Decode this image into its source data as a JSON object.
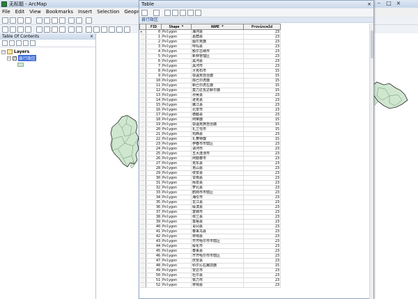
{
  "app": {
    "window_title": "无标题 - ArcMap",
    "menus": [
      "File",
      "Edit",
      "View",
      "Bookmarks",
      "Insert",
      "Selection",
      "Geoprocessing"
    ],
    "toc_title": "Table Of Contents",
    "layers_label": "Layers",
    "layer_name": "县行政区"
  },
  "table_window": {
    "title": "Table",
    "close": "×",
    "tab_label": "县行政区",
    "columns": [
      "FID",
      "Shape *",
      "NAME *",
      "ProvinceId"
    ],
    "rows": [
      [
        "0",
        "Polygon",
        "海河县",
        "23"
      ],
      [
        "1",
        "Polygon",
        "嘉荫县",
        "23"
      ],
      [
        "2",
        "Polygon",
        "图尔克旗",
        "23"
      ],
      [
        "3",
        "Polygon",
        "呼玛县",
        "23"
      ],
      [
        "4",
        "Polygon",
        "额尔古纳市",
        "23"
      ],
      [
        "5",
        "Polygon",
        "新林管理区",
        "23"
      ],
      [
        "6",
        "Polygon",
        "黑河县",
        "23"
      ],
      [
        "7",
        "Polygon",
        "黑河市",
        "23"
      ],
      [
        "8",
        "Polygon",
        "牙克石市",
        "15"
      ],
      [
        "9",
        "Polygon",
        "鄂温克自治旗",
        "15"
      ],
      [
        "10",
        "Polygon",
        "陈巴尔虎旗",
        "15"
      ],
      [
        "11",
        "Polygon",
        "新巴尔虎左旗",
        "15"
      ],
      [
        "12",
        "Polygon",
        "莫力达瓦达斡尔旗",
        "15"
      ],
      [
        "13",
        "Polygon",
        "孙吴县",
        "23"
      ],
      [
        "14",
        "Polygon",
        "逊克县",
        "23"
      ],
      [
        "15",
        "Polygon",
        "嫩江县",
        "23"
      ],
      [
        "16",
        "Polygon",
        "北安市",
        "23"
      ],
      [
        "17",
        "Polygon",
        "德都县",
        "23"
      ],
      [
        "18",
        "Polygon",
        "阿荣旗",
        "15"
      ],
      [
        "19",
        "Polygon",
        "鄂温克族自治旗",
        "15"
      ],
      [
        "20",
        "Polygon",
        "扎兰屯市",
        "15"
      ],
      [
        "21",
        "Polygon",
        "鸡西县",
        "23"
      ],
      [
        "22",
        "Polygon",
        "扎赉特旗",
        "15"
      ],
      [
        "23",
        "Polygon",
        "伊春市市辖区",
        "23"
      ],
      [
        "24",
        "Polygon",
        "讷河市",
        "23"
      ],
      [
        "25",
        "Polygon",
        "五大连池市",
        "23"
      ],
      [
        "26",
        "Polygon",
        "阿勒泰市",
        "23"
      ],
      [
        "27",
        "Polygon",
        "克东县",
        "23"
      ],
      [
        "28",
        "Polygon",
        "克山县",
        "23"
      ],
      [
        "29",
        "Polygon",
        "依安县",
        "23"
      ],
      [
        "30",
        "Polygon",
        "甘南县",
        "23"
      ],
      [
        "31",
        "Polygon",
        "拜泉县",
        "23"
      ],
      [
        "32",
        "Polygon",
        "萝北县",
        "23"
      ],
      [
        "33",
        "Polygon",
        "鹤岗市市辖区",
        "23"
      ],
      [
        "34",
        "Polygon",
        "海伦市",
        "23"
      ],
      [
        "35",
        "Polygon",
        "龙江县",
        "23"
      ],
      [
        "36",
        "Polygon",
        "绥滨县",
        "23"
      ],
      [
        "37",
        "Polygon",
        "富锦市",
        "23"
      ],
      [
        "38",
        "Polygon",
        "依兰县",
        "23"
      ],
      [
        "39",
        "Polygon",
        "富裕县",
        "23"
      ],
      [
        "40",
        "Polygon",
        "青冈县",
        "23"
      ],
      [
        "41",
        "Polygon",
        "泰来乌县",
        "23"
      ],
      [
        "42",
        "Polygon",
        "林甸县",
        "23"
      ],
      [
        "43",
        "Polygon",
        "齐齐哈尔市市辖区",
        "23"
      ],
      [
        "44",
        "Polygon",
        "绥化市",
        "23"
      ],
      [
        "45",
        "Polygon",
        "泰来县",
        "23"
      ],
      [
        "46",
        "Polygon",
        "齐齐哈尔市市辖区",
        "23"
      ],
      [
        "47",
        "Polygon",
        "庆安县",
        "23"
      ],
      [
        "48",
        "Polygon",
        "科尔沁右翼前旗",
        "15"
      ],
      [
        "49",
        "Polygon",
        "安达市",
        "23"
      ],
      [
        "50",
        "Polygon",
        "杜尔县",
        "23"
      ],
      [
        "51",
        "Polygon",
        "铁力市",
        "23"
      ],
      [
        "52",
        "Polygon",
        "林甸县",
        "23"
      ]
    ]
  }
}
